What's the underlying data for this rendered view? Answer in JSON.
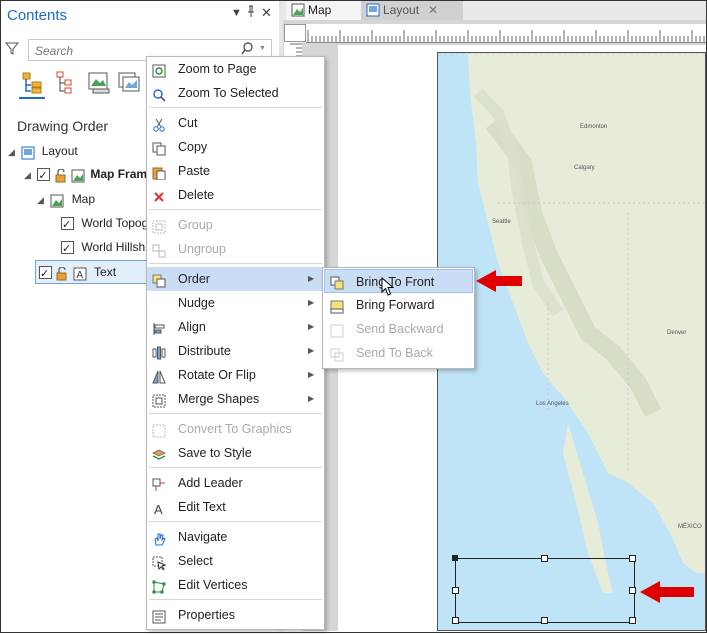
{
  "contents": {
    "title": "Contents",
    "pin_glyph": "▼",
    "close_glyph": "✕",
    "search_placeholder": "Search",
    "heading": "Drawing Order",
    "tree": {
      "layout": "Layout",
      "map_frame": "Map Fram",
      "map": "Map",
      "topo": "World Topog",
      "hillshade": "World Hillsh",
      "text": "Text"
    }
  },
  "tabs": {
    "map": "Map",
    "layout": "Layout"
  },
  "menu": {
    "zoom_to_page": "Zoom to Page",
    "zoom_to_selected": "Zoom To Selected",
    "cut": "Cut",
    "copy": "Copy",
    "paste": "Paste",
    "delete": "Delete",
    "group": "Group",
    "ungroup": "Ungroup",
    "order": "Order",
    "nudge": "Nudge",
    "align": "Align",
    "distribute": "Distribute",
    "rotate_or_flip": "Rotate Or Flip",
    "merge_shapes": "Merge Shapes",
    "convert_to_graphics": "Convert To Graphics",
    "save_to_style": "Save to Style",
    "add_leader": "Add Leader",
    "edit_text": "Edit Text",
    "navigate": "Navigate",
    "select": "Select",
    "edit_vertices": "Edit Vertices",
    "properties": "Properties"
  },
  "submenu": {
    "bring_to_front": "Bring To Front",
    "bring_forward": "Bring Forward",
    "send_backward": "Send Backward",
    "send_to_back": "Send To Back"
  },
  "map_labels": {
    "edmonton": "Edmonton",
    "calgary": "Calgary",
    "seattle": "Seattle",
    "denver": "Denver",
    "los_angeles": "Los Angeles",
    "mexico": "MÉXICO"
  },
  "colors": {
    "accent": "#1b6ac9",
    "highlight": "#c9def5",
    "arrow": "#e00000",
    "ocean": "#bfe3f7"
  }
}
